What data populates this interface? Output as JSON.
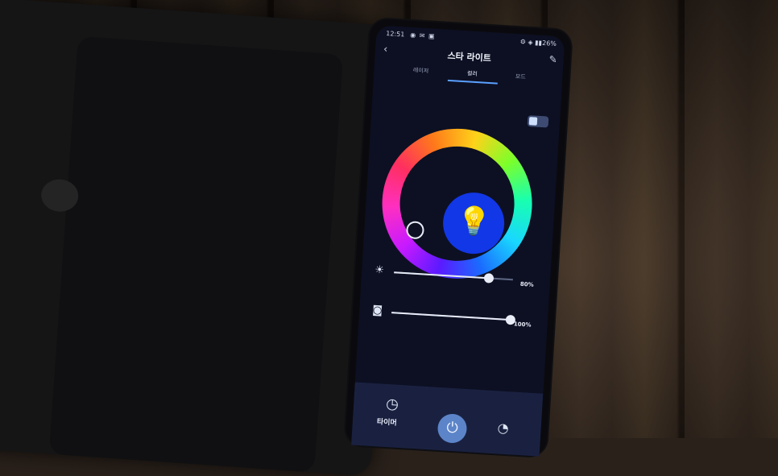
{
  "status_bar": {
    "time": "12:51",
    "battery": "26%",
    "status_icons": "◉ ✉ ▣",
    "signal": "⚙ ◈ ▮▮"
  },
  "app_bar": {
    "title": "스타 라이트",
    "back_icon": "‹",
    "edit_icon": "✎"
  },
  "tabs": [
    {
      "label": "레이저"
    },
    {
      "label": "컬러"
    },
    {
      "label": "모드"
    }
  ],
  "controls": {
    "brightness": {
      "icon": "☀",
      "value_label": "80%",
      "value": 0.8
    },
    "saturation": {
      "icon": "◙",
      "value_label": "100%",
      "value": 1.0
    }
  },
  "bottom_bar": {
    "timer_label": "타이머",
    "timer_icon": "◷",
    "power_icon": "⏻",
    "schedule_icon": "◔"
  },
  "colors": {
    "wheel_center": "#1237e6",
    "accent": "#5aa0ff",
    "power": "#5c84c9"
  }
}
